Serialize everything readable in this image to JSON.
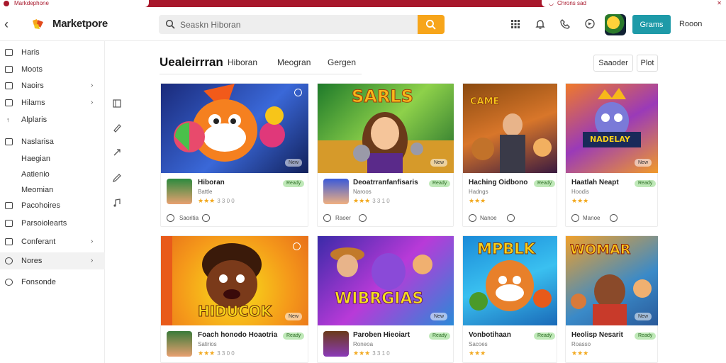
{
  "browser": {
    "tab_title": "Markdephone",
    "right_text": "Chrons sad"
  },
  "header": {
    "logo_text": "Marketpore",
    "search_placeholder": "Seaskn Hiboran",
    "games_button": "Grams",
    "room_label": "Rooon",
    "icons": [
      "grid-icon",
      "bell-icon",
      "phone-icon",
      "chat-icon"
    ]
  },
  "sidebar": {
    "items": [
      {
        "label": "Haris",
        "chevron": false
      },
      {
        "label": "Moots",
        "chevron": false
      },
      {
        "label": "Naoirs",
        "chevron": true
      },
      {
        "label": "Hilams",
        "chevron": true
      },
      {
        "label": "Alplaris",
        "chevron": false
      },
      {
        "label": "Naslarisa",
        "chevron": false
      }
    ],
    "subitems": [
      "Haegian",
      "Aatienio",
      "Meomian"
    ],
    "items2": [
      {
        "label": "Pacohoires",
        "chevron": false,
        "active": false
      },
      {
        "label": "Parsoiolearts",
        "chevron": false,
        "active": false
      },
      {
        "label": "Conferant",
        "chevron": true,
        "active": false
      },
      {
        "label": "Nores",
        "chevron": true,
        "active": true
      },
      {
        "label": "Fonsonde",
        "chevron": false,
        "active": false
      }
    ]
  },
  "main": {
    "title": "Uealeirrran",
    "tabs": [
      "Hiboran",
      "Meogran",
      "Gergen"
    ],
    "sort_label": "Saaoder",
    "filter_label": "Plot"
  },
  "cards": [
    {
      "title": "Hiboran",
      "subtitle": "Battle",
      "tag": "Ready",
      "rating": "3 3 0 0",
      "badge": "New",
      "action": "Saoritia",
      "art": "",
      "stars": "★★★"
    },
    {
      "title": "Deoatrranfanfisaris",
      "subtitle": "Naroos",
      "tag": "Ready",
      "rating": "3 3 1 0",
      "badge": "New",
      "action": "Raoer",
      "art": "SARLS",
      "stars": "★★★"
    },
    {
      "title": "Haching Oidbono",
      "subtitle": "Hadngs",
      "tag": "Ready",
      "rating": "",
      "badge": "",
      "action": "Nanoe",
      "art": "CAME",
      "stars": "★★★"
    },
    {
      "title": "Haatlah Neapt",
      "subtitle": "Hoodis",
      "tag": "Ready",
      "rating": "",
      "badge": "New",
      "action": "Manoe",
      "art": "NADELAY",
      "stars": "★★★"
    },
    {
      "title": "Foach honodo Hoaotria",
      "subtitle": "Satirios",
      "tag": "Ready",
      "rating": "3 3 0 0",
      "badge": "New",
      "action": "",
      "art": "HIDUCOK",
      "stars": "★★★"
    },
    {
      "title": "Paroben Hieoiart",
      "subtitle": "Roneoa",
      "tag": "Ready",
      "rating": "3 3 1 0",
      "badge": "New",
      "action": "",
      "art": "WIBRGIAS",
      "stars": "★★★"
    },
    {
      "title": "Vonbotihaan",
      "subtitle": "Sacoes",
      "tag": "Ready",
      "rating": "",
      "badge": "",
      "action": "",
      "art": "MPBLK",
      "stars": "★★★"
    },
    {
      "title": "Heolisp Nesarit",
      "subtitle": "Roasso",
      "tag": "Ready",
      "rating": "",
      "badge": "New",
      "action": "",
      "art": "WOMAR",
      "stars": "★★★"
    }
  ]
}
